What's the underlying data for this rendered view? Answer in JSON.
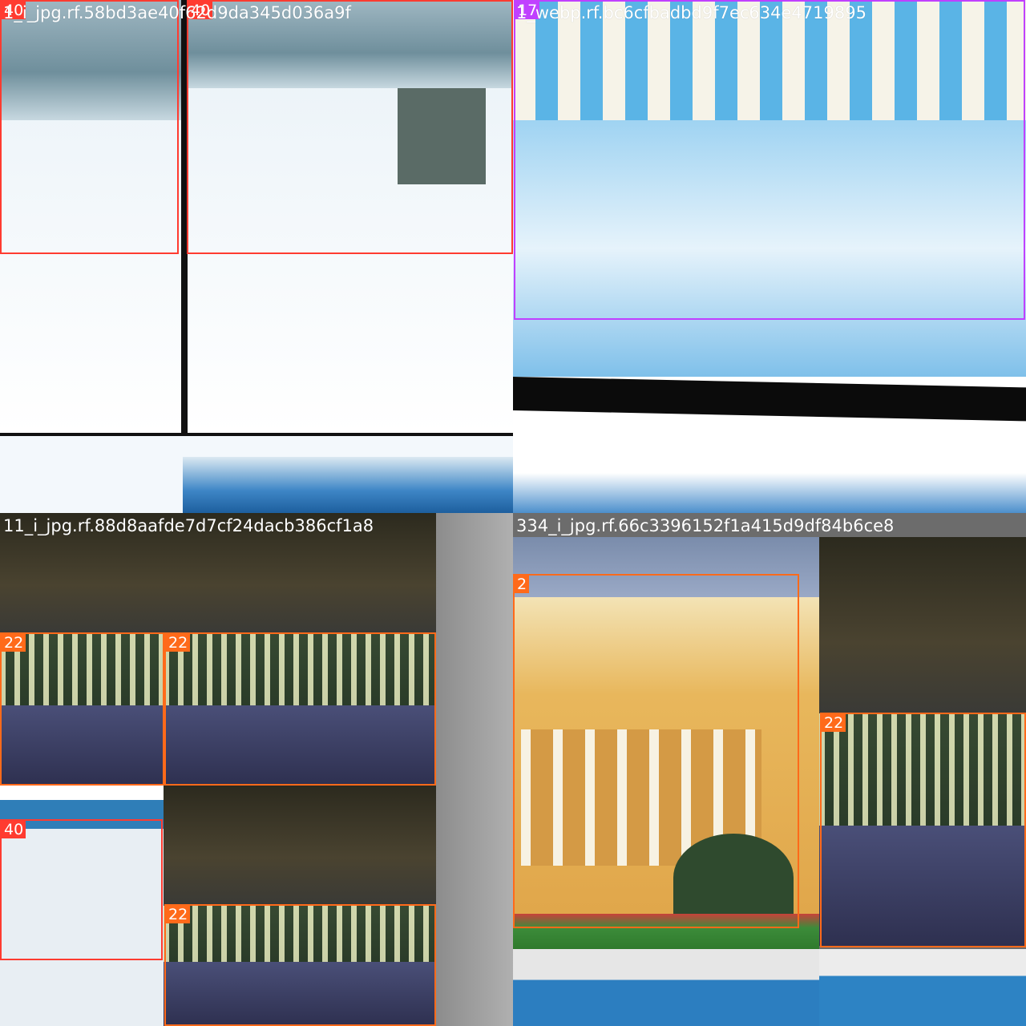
{
  "tiles": [
    {
      "title": "1_i_jpg.rf.58bd3ae40f62d9da345d036a9f",
      "boxes": [
        {
          "label": "40",
          "color": "#ff3b30"
        },
        {
          "label": "40",
          "color": "#ff3b30"
        }
      ]
    },
    {
      "title": "1_webp.rf.bc6cfbadbd9f7ec634e4719895",
      "boxes": [
        {
          "label": "17",
          "color": "#c040ff"
        }
      ]
    },
    {
      "title": "11_i_jpg.rf.88d8aafde7d7cf24dacb386cf1a8",
      "boxes": [
        {
          "label": "22",
          "color": "#ff6a1a"
        },
        {
          "label": "22",
          "color": "#ff6a1a"
        },
        {
          "label": "40",
          "color": "#ff3b30"
        },
        {
          "label": "22",
          "color": "#ff6a1a"
        }
      ]
    },
    {
      "title": "334_i_jpg.rf.66c3396152f1a415d9df84b6ce8",
      "boxes": [
        {
          "label": "2",
          "color": "#ff6a1a"
        },
        {
          "label": "22",
          "color": "#ff6a1a"
        }
      ]
    }
  ]
}
